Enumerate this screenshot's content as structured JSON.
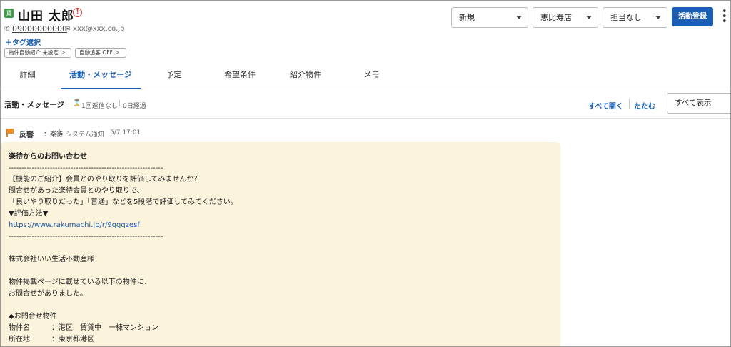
{
  "customer": {
    "badge": "賃",
    "name": "山田 太郎",
    "alert": "!",
    "phone": "09000000000",
    "email": "xxx@xxx.co.jp",
    "tag_select": "＋タグ選択",
    "pills": [
      "物件自動紹介 未設定 ＞",
      "自動追客 OFF ＞"
    ]
  },
  "header": {
    "status_select": "新規",
    "store_select": "恵比寿店",
    "owner_select": "担当なし",
    "register_button": "活動登録",
    "more": "⋮"
  },
  "tabs": [
    {
      "label": "詳細",
      "active": false
    },
    {
      "label": "活動・メッセージ",
      "active": true
    },
    {
      "label": "予定",
      "active": false
    },
    {
      "label": "希望条件",
      "active": false
    },
    {
      "label": "紹介物件",
      "active": false
    },
    {
      "label": "メモ",
      "active": false
    }
  ],
  "section": {
    "title": "活動・メッセージ",
    "replies": "1回返信なし",
    "elapsed": "0日経過",
    "expand_all": "すべて開く",
    "collapse": "たたむ",
    "filter_select": "すべて表示"
  },
  "message": {
    "type": "反響",
    "source": "：楽待",
    "separator": "|",
    "kind": "システム通知",
    "time": "5/7 17:01",
    "lines": [
      "楽待からのお問い合わせ",
      "------------------------------------------------------------",
      "【機能のご紹介】会員とのやり取りを評価してみませんか？",
      "問合せがあった楽待会員とのやり取りで、",
      "「良いやり取りだった」「普通」などを5段階で評価してみてください。",
      "▼評価方法▼",
      "https://www.rakumachi.jp/r/9qgqzesf",
      "------------------------------------------------------------",
      "",
      "株式会社いい生活不動産様",
      "",
      "物件掲載ページに載せている以下の物件に、",
      "お問合せがありました。",
      "",
      "◆お問合せ物件",
      "物件名　　　：港区　賃貸中　一棟マンション",
      "所在地　　　：東京都港区"
    ]
  },
  "colors": {
    "accent": "#1a5fb4",
    "bubble": "#fcf3dc",
    "alert": "#e03a3a",
    "flag": "#f08a24",
    "badge": "#3f9b4a"
  }
}
